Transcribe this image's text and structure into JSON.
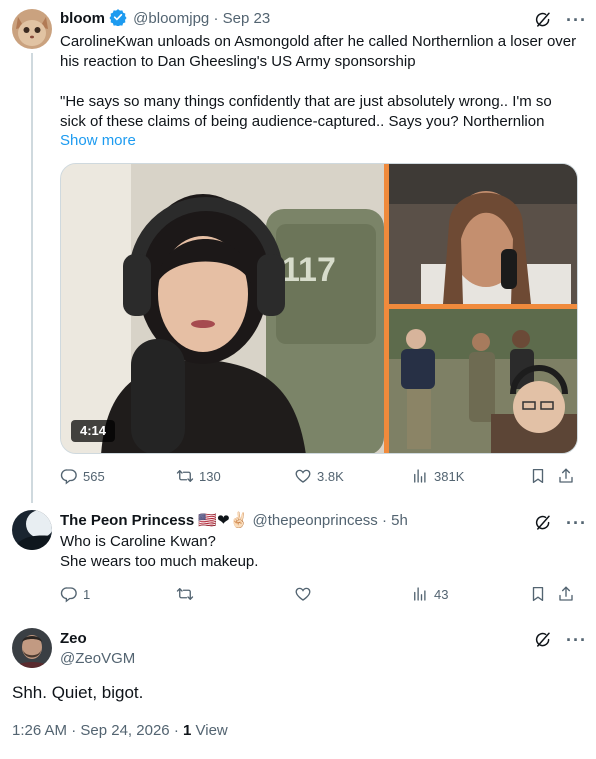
{
  "tweet1": {
    "author_name": "bloom",
    "handle": "@bloomjpg",
    "separator": "·",
    "date": "Sep 23",
    "text": "CarolineKwan unloads on Asmongold after he called Northernlion a loser over his reaction to Dan Gheesling's US Army sponsorship\n\n\"He says so many things confidently that are just absolutely wrong.. I'm so sick of these claims of being audience-captured.. Says you? Northernlion",
    "show_more": "Show more",
    "video_duration": "4:14",
    "watermark": "117",
    "stats": {
      "replies": "565",
      "reposts": "130",
      "likes": "3.8K",
      "views": "381K"
    }
  },
  "tweet2": {
    "author_name": "The Peon Princess",
    "name_emoji": "🇺🇸❤✌🏻",
    "handle": "@thepeonprincess",
    "separator": "·",
    "date": "5h",
    "text": "Who is Caroline Kwan?\nShe wears too much makeup.",
    "stats": {
      "replies": "1",
      "views": "43"
    }
  },
  "main_tweet": {
    "author_name": "Zeo",
    "handle": "@ZeoVGM",
    "text": "Shh. Quiet, bigot.",
    "time": "1:26 AM",
    "separator": "·",
    "date": "Sep 24, 2026",
    "views_count": "1",
    "views_label": "View"
  },
  "icons": [
    "verified-badge-icon",
    "grok-icon",
    "more-icon",
    "reply-icon",
    "repost-icon",
    "like-icon",
    "views-icon",
    "bookmark-icon",
    "share-icon"
  ],
  "colors": {
    "accent": "#1d9bf0",
    "muted": "#536471",
    "text": "#0f1419",
    "divider": "#cfd9de",
    "video_split": "#f08a3c"
  }
}
